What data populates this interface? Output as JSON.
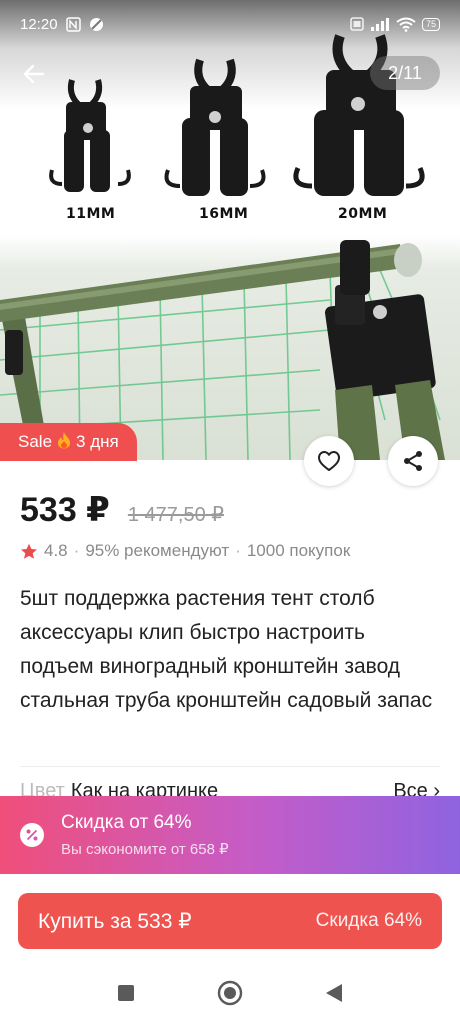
{
  "status_bar": {
    "time": "12:20",
    "battery": "75"
  },
  "gallery": {
    "counter": "2/11",
    "size_labels": [
      "11MM",
      "16MM",
      "20MM"
    ]
  },
  "badges": {
    "sale_label": "Sale",
    "sale_days": "3 дня"
  },
  "product": {
    "price": "533 ₽",
    "old_price": "1 477,50 ₽",
    "rating": "4.8",
    "recommend": "95% рекомендуют",
    "purchases": "1000 покупок",
    "title": "5шт поддержка растения тент столб аксессуары клип быстро настроить подъем виноградный кронштейн завод стальная труба кронштейн садовый запас"
  },
  "color_row": {
    "label": "Цвет",
    "value": "Как на картинке",
    "all": "Все ›"
  },
  "discount": {
    "title": "Скидка от 64%",
    "subtitle": "Вы сэкономите от 658 ₽"
  },
  "buy": {
    "label": "Купить за 533 ₽",
    "discount": "Скидка 64%"
  },
  "colors": {
    "accent": "#ef5350",
    "sale": "#ef4f4f",
    "star": "#e94e4e",
    "banner_start": "#f04f7a",
    "banner_end": "#8f63e0"
  }
}
